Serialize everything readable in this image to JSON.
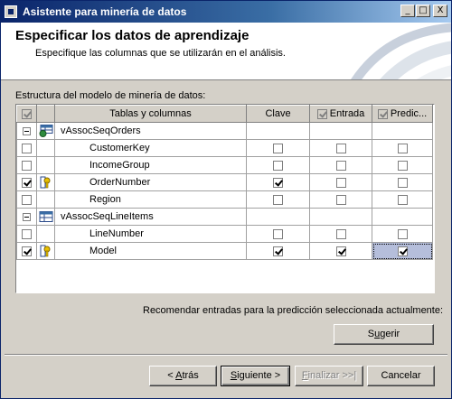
{
  "window": {
    "title": "Asistente para minería de datos",
    "buttons": {
      "minimize": "_",
      "maximize": "□",
      "close": "X"
    }
  },
  "header": {
    "title": "Especificar los datos de aprendizaje",
    "subtitle": "Especifique las columnas que se utilizarán en el análisis."
  },
  "structure_label": "Estructura del modelo de minería de datos:",
  "grid": {
    "columns": {
      "tables_columns": "Tablas y columnas",
      "key": "Clave",
      "input": "Entrada",
      "predict": "Predic..."
    },
    "header_checks": {
      "select": true,
      "input": true,
      "predict": true
    },
    "rows": [
      {
        "type": "table",
        "name": "vAssocSeqOrders",
        "icon": "table-view-icon"
      },
      {
        "type": "column",
        "name": "CustomerKey",
        "select": false,
        "key": false,
        "input": false,
        "predict": false
      },
      {
        "type": "column",
        "name": "IncomeGroup",
        "select": false,
        "key": false,
        "input": false,
        "predict": false
      },
      {
        "type": "column",
        "name": "OrderNumber",
        "select": true,
        "keyicon": true,
        "key": true,
        "input": false,
        "predict": false
      },
      {
        "type": "column",
        "name": "Region",
        "select": false,
        "key": false,
        "input": false,
        "predict": false
      },
      {
        "type": "table",
        "name": "vAssocSeqLineItems",
        "icon": "table-icon"
      },
      {
        "type": "column",
        "name": "LineNumber",
        "select": false,
        "key": false,
        "input": false,
        "predict": false
      },
      {
        "type": "column",
        "name": "Model",
        "select": true,
        "keyicon": true,
        "key": true,
        "input": true,
        "predict": true
      }
    ]
  },
  "recommend_label": "Recomendar entradas para la predicción seleccionada actualmente:",
  "buttons": {
    "suggest_pre": "S",
    "suggest_u": "u",
    "suggest_post": "gerir",
    "back_pre": "< ",
    "back_u": "A",
    "back_post": "trás",
    "next_u": "S",
    "next_post": "iguiente >",
    "finish_u": "F",
    "finish_post": "inalizar >>|",
    "cancel": "Cancelar"
  }
}
